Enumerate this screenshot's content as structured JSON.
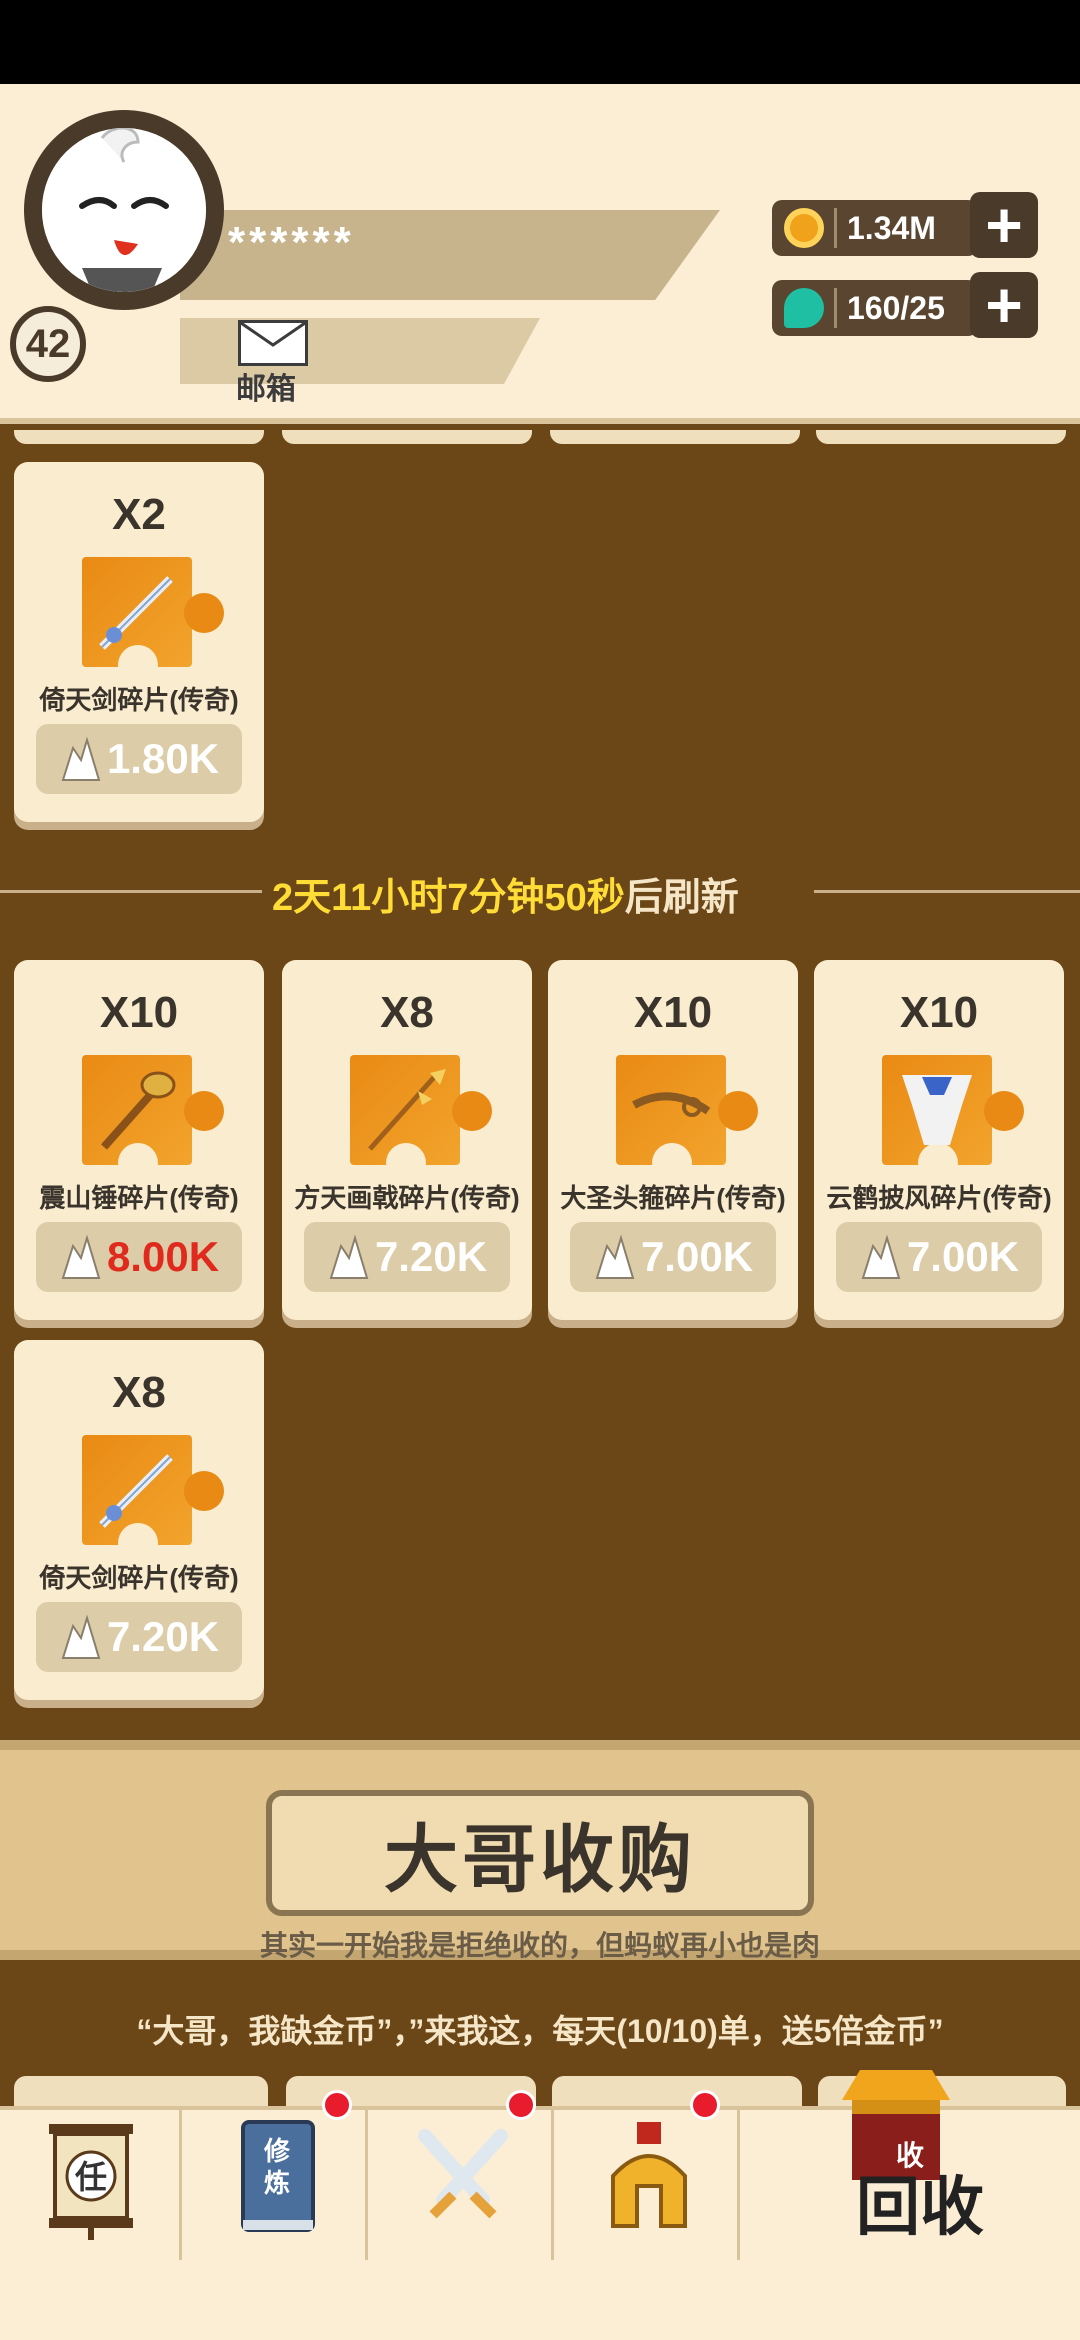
{
  "player": {
    "level": "42",
    "name": "******",
    "mail_label": "邮箱"
  },
  "resources": {
    "gold": "1.34M",
    "gems": "160/25"
  },
  "shop": {
    "section1": [
      {
        "qty": "X2",
        "name": "倚天剑碎片(传奇)",
        "price": "1.80K",
        "price_red": false,
        "icon": "sword-icon"
      }
    ],
    "refresh": {
      "time": "2天11小时7分钟50秒",
      "suffix": "后刷新"
    },
    "section2": [
      {
        "qty": "X10",
        "name": "震山锤碎片(传奇)",
        "price": "8.00K",
        "price_red": true,
        "icon": "hammer-icon"
      },
      {
        "qty": "X8",
        "name": "方天画戟碎片(传奇)",
        "price": "7.20K",
        "price_red": false,
        "icon": "halberd-icon"
      },
      {
        "qty": "X10",
        "name": "大圣头箍碎片(传奇)",
        "price": "7.00K",
        "price_red": false,
        "icon": "headband-icon"
      },
      {
        "qty": "X10",
        "name": "云鹤披风碎片(传奇)",
        "price": "7.00K",
        "price_red": false,
        "icon": "cloak-icon"
      },
      {
        "qty": "X8",
        "name": "倚天剑碎片(传奇)",
        "price": "7.20K",
        "price_red": false,
        "icon": "sword-icon"
      }
    ]
  },
  "buy_banner": {
    "title": "大哥收购",
    "subtitle": "其实一开始我是拒绝收的，但蚂蚁再小也是肉",
    "order_text": "“大哥，我缺金币”，”来我这，每天(10/10)单，送5倍金币”"
  },
  "nav": {
    "task_glyph": "任",
    "train_glyph": "修炼",
    "recycle_small": "收",
    "recycle_label": "回收"
  },
  "colors": {
    "background": "#6b4617",
    "card": "#faedcf",
    "timer": "#ffdc36",
    "price_alert": "#e02a1e",
    "badge": "#e81c2c"
  }
}
